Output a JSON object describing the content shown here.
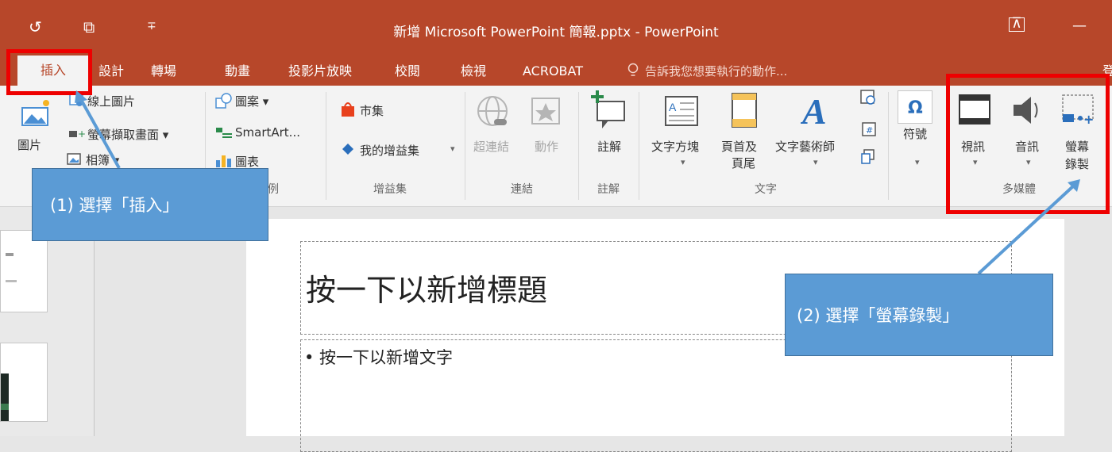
{
  "titlebar": {
    "title": "新增 Microsoft PowerPoint 簡報.pptx - PowerPoint",
    "qat_undo": "↺",
    "qat_present": "⧉",
    "qat_more": "∓",
    "restore_glyph": "⊼",
    "minimize_glyph": "—"
  },
  "tabs": [
    "插入",
    "設計",
    "轉場",
    "動畫",
    "投影片放映",
    "校閱",
    "檢視",
    "ACROBAT"
  ],
  "tellme": "告訴我您想要執行的動作...",
  "signin": "登",
  "ribbon": {
    "images": {
      "picture": "圖片",
      "online_picture": "線上圖片",
      "screenshot": "螢幕擷取畫面 ▾",
      "album": "相簿 ▾"
    },
    "illustrations": {
      "shapes": "圖案 ▾",
      "smartart": "SmartArt...",
      "chart": "圖表",
      "group": "例"
    },
    "addins": {
      "store": "市集",
      "my_addins": "我的增益集",
      "group": "增益集"
    },
    "links": {
      "hyperlink": "超連結",
      "action": "動作",
      "group": "連結"
    },
    "comments": {
      "comment": "註解",
      "group": "註解"
    },
    "text": {
      "textbox": "文字方塊",
      "header_footer_1": "頁首及",
      "header_footer_2": "頁尾",
      "wordart": "文字藝術師",
      "group": "文字"
    },
    "symbols": {
      "symbol": "符號"
    },
    "media": {
      "video": "視訊",
      "audio": "音訊",
      "screen_rec_1": "螢幕",
      "screen_rec_2": "錄製",
      "group": "多媒體"
    }
  },
  "slide": {
    "title_placeholder": "按一下以新增標題",
    "body_placeholder": "• 按一下以新增文字"
  },
  "annotations": {
    "step1": "(1) 選擇「插入」",
    "step2": "(2)  選擇「螢幕錄製」"
  }
}
